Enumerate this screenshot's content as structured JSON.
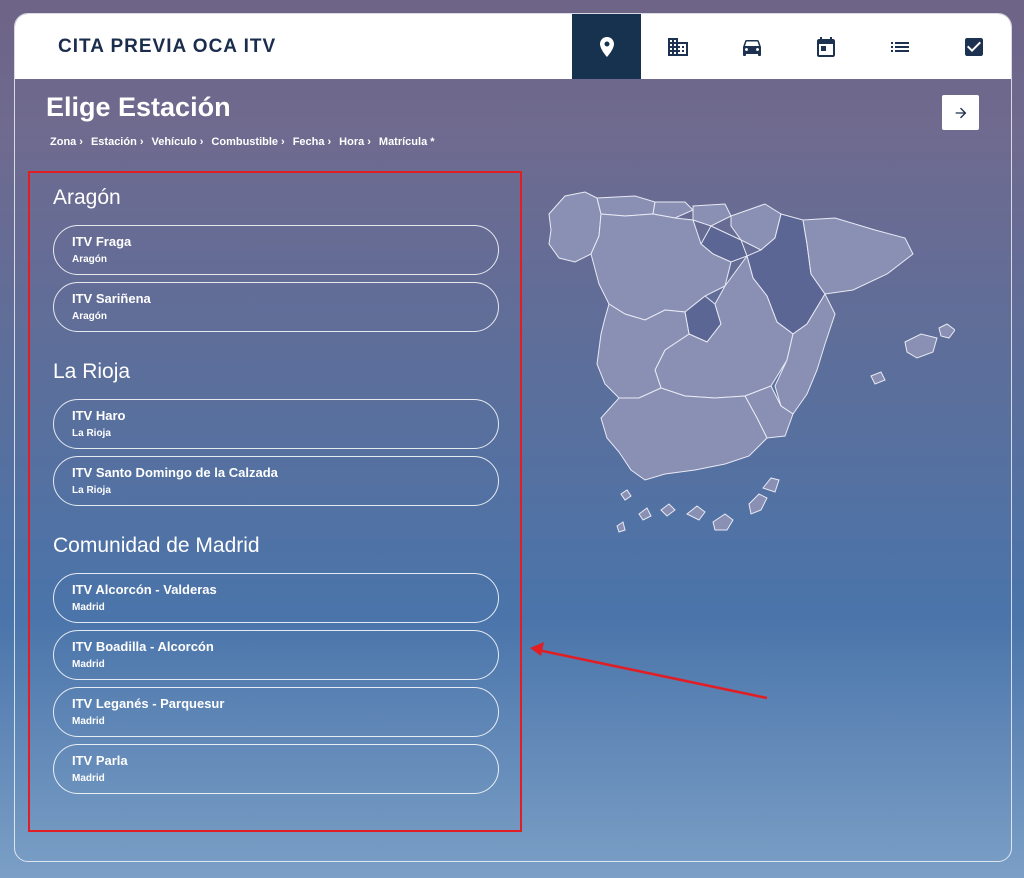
{
  "header": {
    "brand": "CITA PREVIA OCA ITV",
    "steps": [
      {
        "icon": "map-pin-icon",
        "active": true
      },
      {
        "icon": "building-icon",
        "active": false
      },
      {
        "icon": "car-icon",
        "active": false
      },
      {
        "icon": "calendar-icon",
        "active": false
      },
      {
        "icon": "list-icon",
        "active": false
      },
      {
        "icon": "checkbox-icon",
        "active": false
      }
    ]
  },
  "page": {
    "title": "Elige Estación",
    "next_icon": "arrow-right-icon"
  },
  "breadcrumb": [
    "Zona",
    "Estación",
    "Vehículo",
    "Combustible",
    "Fecha",
    "Hora",
    "Matrícula *"
  ],
  "regions": [
    {
      "name": "Aragón",
      "stations": [
        {
          "name": "ITV Fraga",
          "sub": "Aragón"
        },
        {
          "name": "ITV Sariñena",
          "sub": "Aragón"
        }
      ]
    },
    {
      "name": "La Rioja",
      "stations": [
        {
          "name": "ITV Haro",
          "sub": "La Rioja"
        },
        {
          "name": "ITV Santo Domingo de la Calzada",
          "sub": "La Rioja"
        }
      ]
    },
    {
      "name": "Comunidad de Madrid",
      "stations": [
        {
          "name": "ITV Alcorcón - Valderas",
          "sub": "Madrid"
        },
        {
          "name": "ITV Boadilla - Alcorcón",
          "sub": "Madrid"
        },
        {
          "name": "ITV Leganés - Parquesur",
          "sub": "Madrid"
        },
        {
          "name": "ITV Parla",
          "sub": "Madrid"
        }
      ]
    }
  ],
  "colors": {
    "brand": "#16324f",
    "highlight": "#e01e24",
    "map_region": "#8a90b4",
    "map_selected": "#5c6694"
  }
}
